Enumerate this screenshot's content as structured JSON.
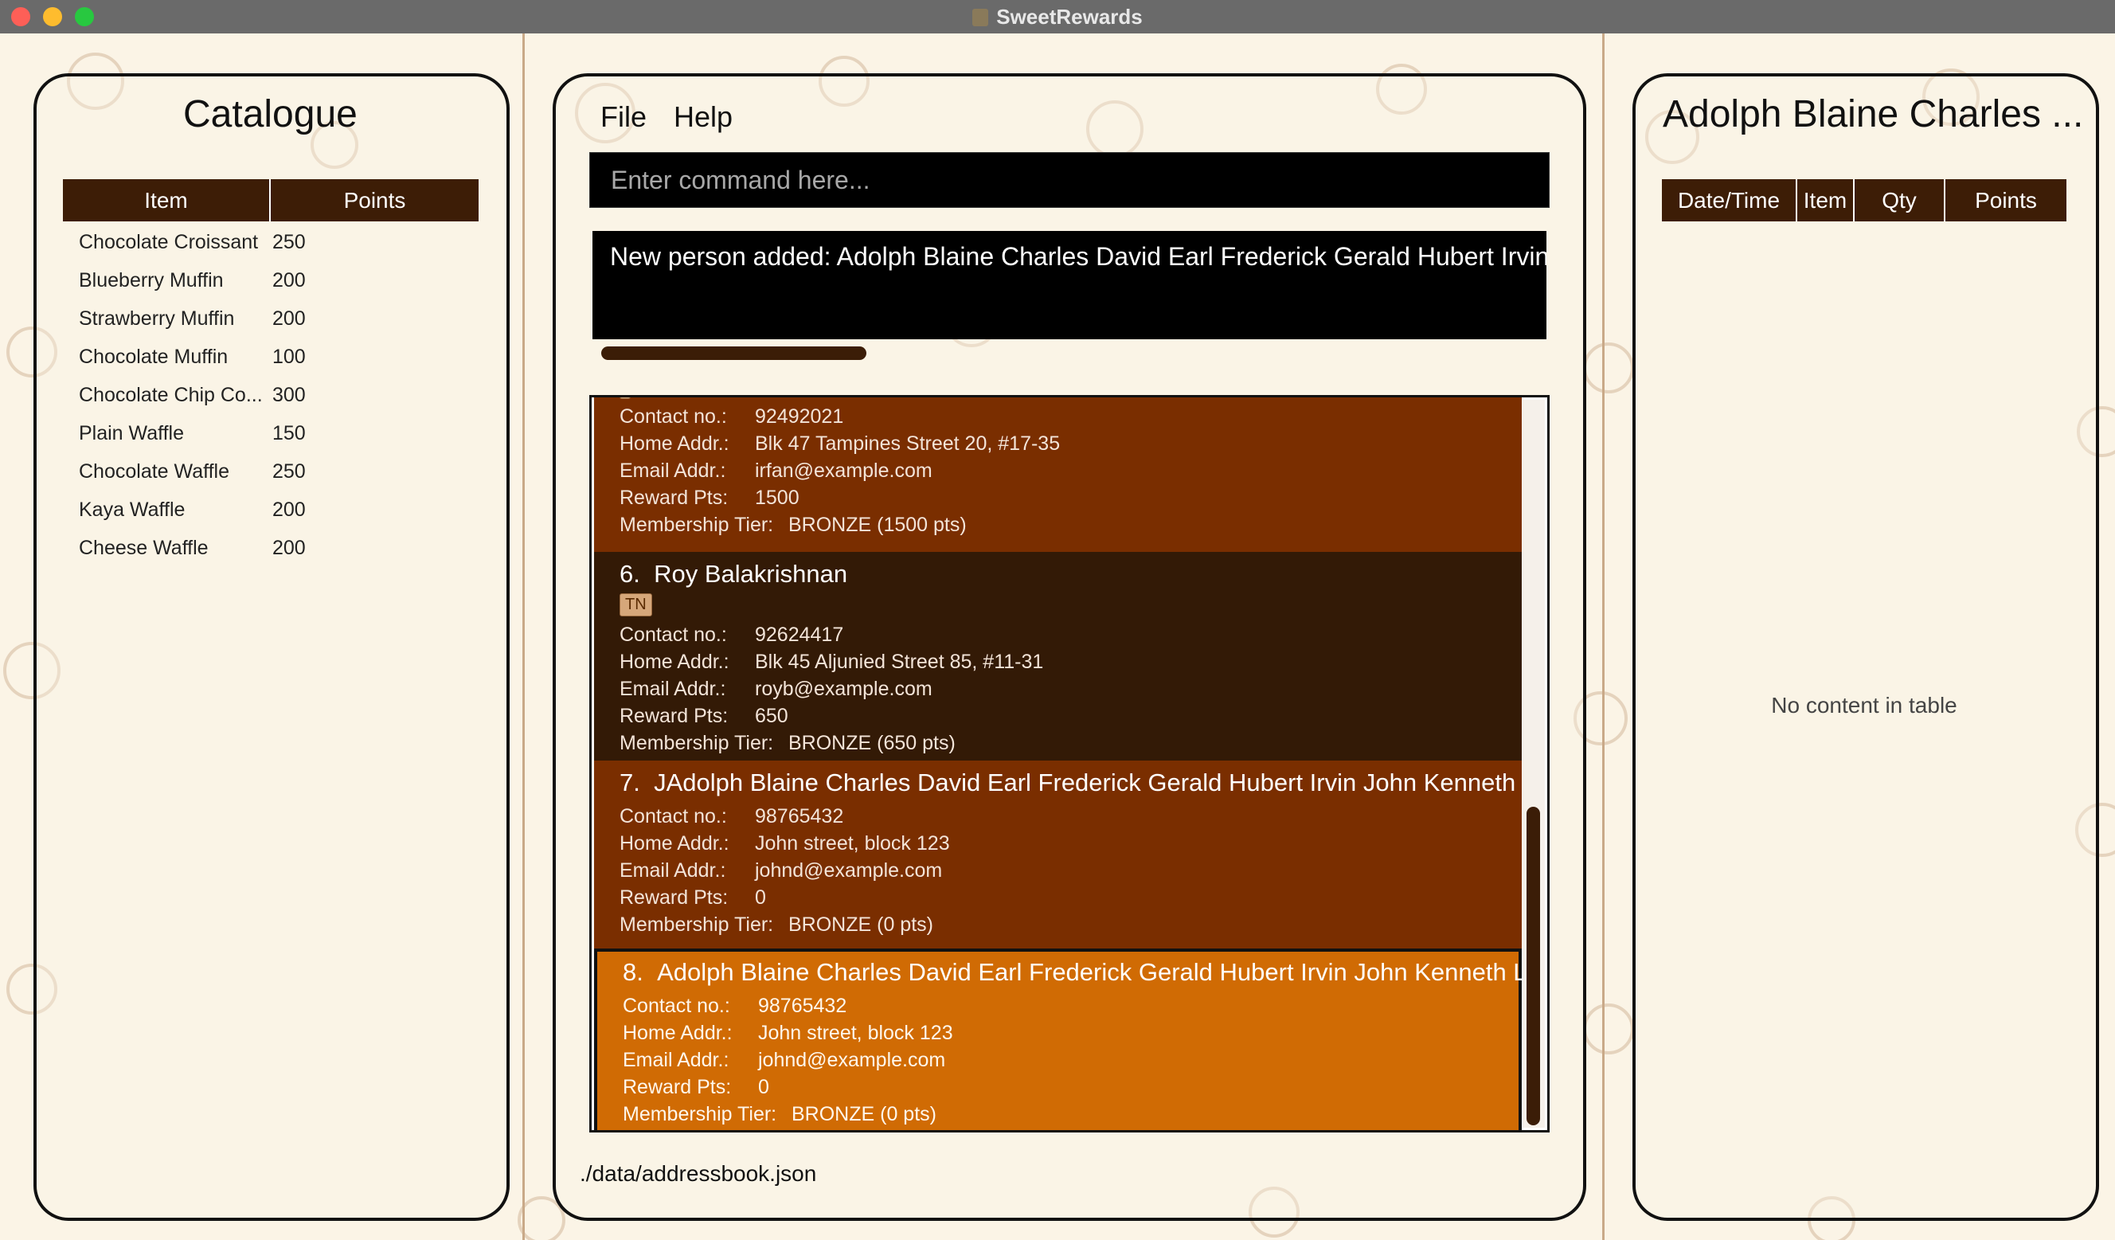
{
  "window": {
    "title": "SweetRewards"
  },
  "catalogue": {
    "title": "Catalogue",
    "headers": [
      "Item",
      "Points"
    ],
    "rows": [
      {
        "item": "Chocolate Croissant",
        "points": "250"
      },
      {
        "item": "Blueberry Muffin",
        "points": "200"
      },
      {
        "item": "Strawberry Muffin",
        "points": "200"
      },
      {
        "item": "Chocolate Muffin",
        "points": "100"
      },
      {
        "item": "Chocolate Chip Co...",
        "points": "300"
      },
      {
        "item": "Plain Waffle",
        "points": "150"
      },
      {
        "item": "Chocolate Waffle",
        "points": "250"
      },
      {
        "item": "Kaya Waffle",
        "points": "200"
      },
      {
        "item": "Cheese Waffle",
        "points": "200"
      }
    ]
  },
  "menu": {
    "file": "File",
    "help": "Help"
  },
  "command": {
    "placeholder": "Enter command here...",
    "value": ""
  },
  "result": {
    "text": "New person added: Adolph Blaine Charles David Earl Frederick Gerald Hubert Irvin"
  },
  "labels": {
    "contact": "Contact no.:",
    "home": "Home Addr.:",
    "email": "Email Addr.:",
    "points": "Reward Pts:",
    "tier": "Membership Tier:"
  },
  "persons": [
    {
      "contact": "92492021",
      "home": "Blk 47 Tampines Street 20, #17-35",
      "email": "irfan@example.com",
      "points": "1500",
      "tier": "BRONZE (1500 pts)"
    },
    {
      "index": "6.",
      "name": "Roy Balakrishnan",
      "tag": "TN",
      "contact": "92624417",
      "home": "Blk 45 Aljunied Street 85, #11-31",
      "email": "royb@example.com",
      "points": "650",
      "tier": "BRONZE (650 pts)"
    },
    {
      "index": "7.",
      "name": "JAdolph Blaine Charles David Earl Frederick Gerald Hubert Irvin John Kenneth L...",
      "contact": "98765432",
      "home": "John street, block 123",
      "email": "johnd@example.com",
      "points": "0",
      "tier": "BRONZE (0 pts)"
    },
    {
      "index": "8.",
      "name": "Adolph Blaine Charles David Earl Frederick Gerald Hubert Irvin John Kenneth Ll...",
      "contact": "98765432",
      "home": "John street, block 123",
      "email": "johnd@example.com",
      "points": "0",
      "tier": "BRONZE (0 pts)"
    }
  ],
  "status": {
    "path": "./data/addressbook.json"
  },
  "transactions": {
    "title": "Adolph Blaine Charles ...",
    "headers": [
      "Date/Time",
      "Item",
      "Qty",
      "Points"
    ],
    "empty": "No content in table"
  }
}
